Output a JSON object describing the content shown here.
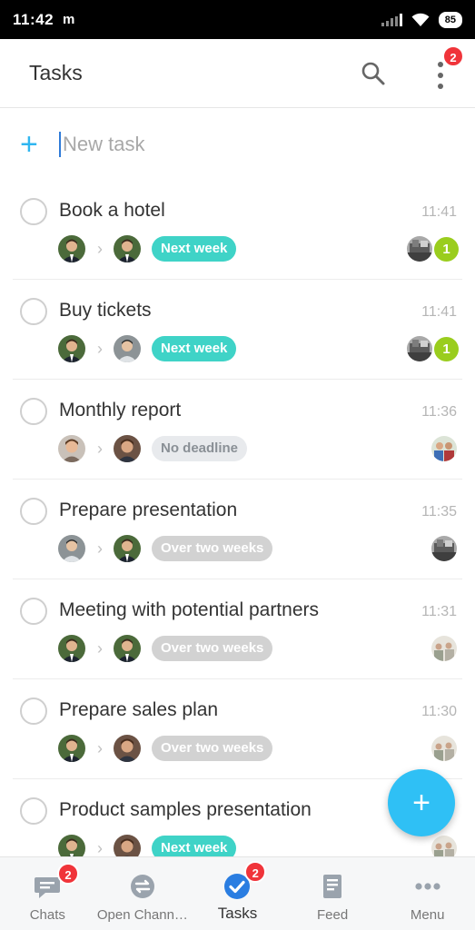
{
  "status_bar": {
    "time": "11:42",
    "carrier_logo": "m",
    "battery": "85"
  },
  "header": {
    "title": "Tasks",
    "menu_badge": "2"
  },
  "new_task": {
    "placeholder": "New task"
  },
  "tasks": [
    {
      "title": "Book a hotel",
      "time": "11:41",
      "deadline": "Next week",
      "deadline_style": "teal",
      "unread": "1",
      "from_avatar": "man-green",
      "to_avatar": "man-green",
      "group": "bw"
    },
    {
      "title": "Buy tickets",
      "time": "11:41",
      "deadline": "Next week",
      "deadline_style": "teal",
      "unread": "1",
      "from_avatar": "man-green",
      "to_avatar": "man-grey",
      "group": "bw"
    },
    {
      "title": "Monthly report",
      "time": "11:36",
      "deadline": "No deadline",
      "deadline_style": "light",
      "unread": "",
      "from_avatar": "man-smile",
      "to_avatar": "man-brown",
      "group": "color"
    },
    {
      "title": "Prepare presentation",
      "time": "11:35",
      "deadline": "Over two weeks",
      "deadline_style": "grey",
      "unread": "",
      "from_avatar": "man-grey",
      "to_avatar": "man-green",
      "group": "bw"
    },
    {
      "title": "Meeting with potential partners",
      "time": "11:31",
      "deadline": "Over two weeks",
      "deadline_style": "grey",
      "unread": "",
      "from_avatar": "man-green",
      "to_avatar": "man-green",
      "group": "pale"
    },
    {
      "title": "Prepare sales plan",
      "time": "11:30",
      "deadline": "Over two weeks",
      "deadline_style": "grey",
      "unread": "",
      "from_avatar": "man-green",
      "to_avatar": "man-brown",
      "group": "pale"
    },
    {
      "title": "Product samples presentation",
      "time": "",
      "deadline": "Next week",
      "deadline_style": "teal",
      "unread": "",
      "from_avatar": "man-green",
      "to_avatar": "man-brown",
      "group": "pale"
    }
  ],
  "fab": {
    "icon": "plus-icon",
    "label": "+"
  },
  "bottom_nav": [
    {
      "label": "Chats",
      "icon": "chat-icon",
      "badge": "2",
      "active": false
    },
    {
      "label": "Open Chann…",
      "icon": "open-channels-icon",
      "badge": "",
      "active": false
    },
    {
      "label": "Tasks",
      "icon": "tasks-check-icon",
      "badge": "2",
      "active": true
    },
    {
      "label": "Feed",
      "icon": "feed-icon",
      "badge": "",
      "active": false
    },
    {
      "label": "Menu",
      "icon": "menu-dots-icon",
      "badge": "",
      "active": false
    }
  ],
  "colors": {
    "accent": "#2fc0f5",
    "teal_chip": "#3fd3c7",
    "badge": "#f0343a",
    "unread": "#9acd1e"
  }
}
